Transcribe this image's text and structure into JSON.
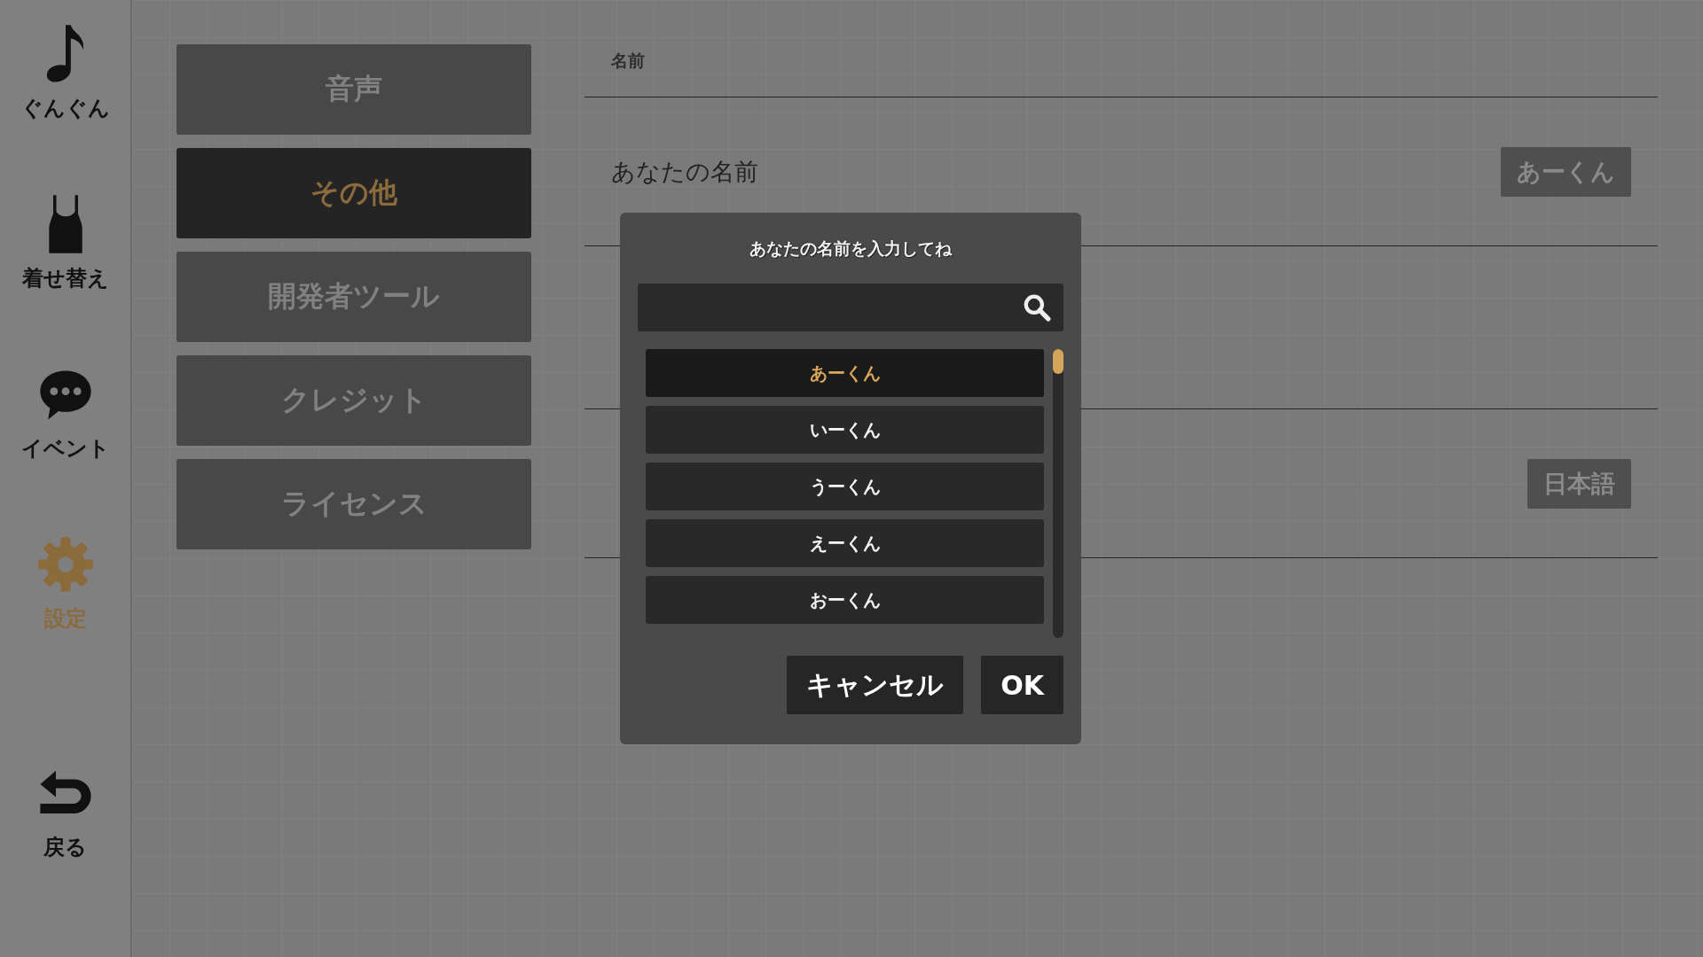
{
  "sidebar": {
    "items": [
      {
        "label": "ぐんぐん",
        "selected": false
      },
      {
        "label": "着せ替え",
        "selected": false
      },
      {
        "label": "イベント",
        "selected": false
      },
      {
        "label": "設定",
        "selected": true
      }
    ],
    "back_button": {
      "label": "戻る"
    }
  },
  "menu": [
    {
      "label": "音声",
      "selected": false
    },
    {
      "label": "その他",
      "selected": true
    },
    {
      "label": "開発者ツール",
      "selected": false
    },
    {
      "label": "クレジット",
      "selected": false
    },
    {
      "label": "ライセンス",
      "selected": false
    }
  ],
  "sections": [
    {
      "header": "名前",
      "rows": [
        {
          "label": "あなたの名前",
          "value": "あーくん"
        }
      ]
    },
    {
      "rows": [
        {
          "value": "日本語"
        }
      ]
    }
  ],
  "dialog": {
    "title": "あなたの名前を入力してね",
    "items": [
      {
        "label": "あーくん",
        "selected": true
      },
      {
        "label": "いーくん",
        "selected": false
      },
      {
        "label": "うーくん",
        "selected": false
      },
      {
        "label": "えーくん",
        "selected": false
      },
      {
        "label": "おーくん",
        "selected": false
      }
    ],
    "buttons": [
      "キャンセル",
      "OK"
    ]
  }
}
